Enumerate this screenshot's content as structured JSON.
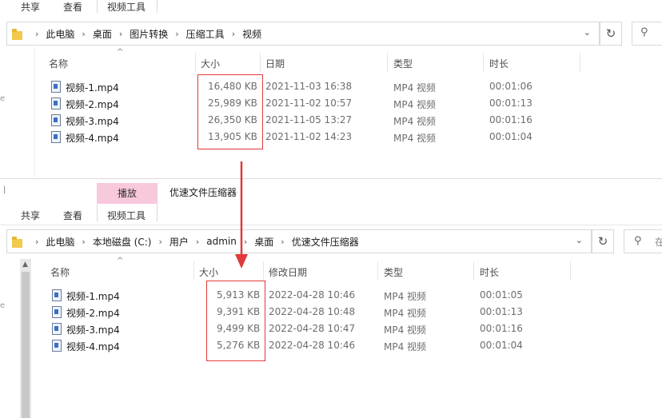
{
  "top_window": {
    "tabs": [
      "共享",
      "查看",
      "视频工具"
    ],
    "breadcrumb": [
      "此电脑",
      "桌面",
      "图片转换",
      "压缩工具",
      "视频"
    ],
    "columns": [
      "名称",
      "大小",
      "日期",
      "类型",
      "时长"
    ],
    "files": [
      {
        "name": "视频-1.mp4",
        "size": "16,480 KB",
        "date": "2021-11-03 16:38",
        "type": "MP4 视频",
        "duration": "00:01:06"
      },
      {
        "name": "视频-2.mp4",
        "size": "25,989 KB",
        "date": "2021-11-02 10:57",
        "type": "MP4 视频",
        "duration": "00:01:13"
      },
      {
        "name": "视频-3.mp4",
        "size": "26,350 KB",
        "date": "2021-11-05 13:27",
        "type": "MP4 视频",
        "duration": "00:01:16"
      },
      {
        "name": "视频-4.mp4",
        "size": "13,905 KB",
        "date": "2021-11-02 14:23",
        "type": "MP4 视频",
        "duration": "00:01:04"
      }
    ]
  },
  "bottom_window": {
    "context_group": "播放",
    "title": "优速文件压缩器",
    "tabs": [
      "共享",
      "查看",
      "视频工具"
    ],
    "breadcrumb": [
      "此电脑",
      "本地磁盘 (C:)",
      "用户",
      "admin",
      "桌面",
      "优速文件压缩器"
    ],
    "search_partial": "在",
    "columns": [
      "名称",
      "大小",
      "修改日期",
      "类型",
      "时长"
    ],
    "files": [
      {
        "name": "视频-1.mp4",
        "size": "5,913 KB",
        "date": "2022-04-28 10:46",
        "type": "MP4 视频",
        "duration": "00:01:05"
      },
      {
        "name": "视频-2.mp4",
        "size": "9,391 KB",
        "date": "2022-04-28 10:48",
        "type": "MP4 视频",
        "duration": "00:01:13"
      },
      {
        "name": "视频-3.mp4",
        "size": "9,499 KB",
        "date": "2022-04-28 10:47",
        "type": "MP4 视频",
        "duration": "00:01:16"
      },
      {
        "name": "视频-4.mp4",
        "size": "5,276 KB",
        "date": "2022-04-28 10:46",
        "type": "MP4 视频",
        "duration": "00:01:04"
      }
    ]
  },
  "colors": {
    "highlight": "#e03a3a",
    "arrow": "#e03a3a",
    "context_tab": "#f8c8dc",
    "folder": "#f2c94c"
  }
}
